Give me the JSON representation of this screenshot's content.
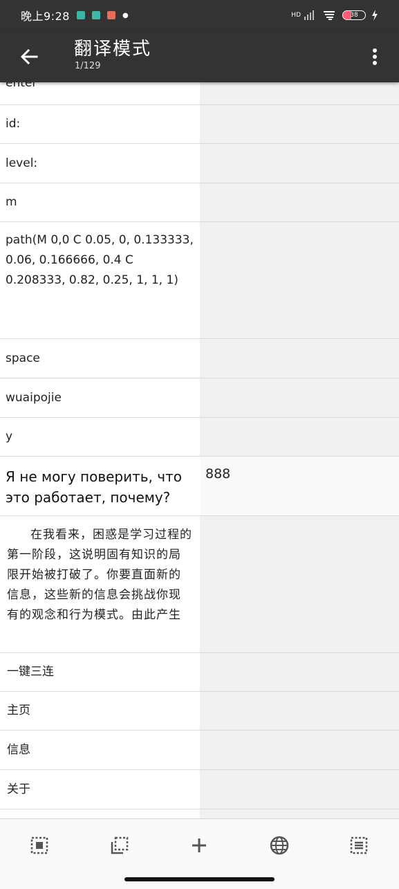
{
  "status_bar": {
    "time": "晚上9:28",
    "network": "HD",
    "battery": "38",
    "battery_level": 0.38,
    "notification_colors": [
      "#36b6a4",
      "#3fb8a8",
      "#e86a5a"
    ]
  },
  "app_bar": {
    "title": "翻译模式",
    "page_indicator": "1/129"
  },
  "rows": [
    {
      "source": "enter",
      "target": ""
    },
    {
      "source": "id:",
      "target": ""
    },
    {
      "source": "level:",
      "target": ""
    },
    {
      "source": "m",
      "target": ""
    },
    {
      "source": "path(M 0,0 C 0.05, 0, 0.133333, 0.06, 0.166666, 0.4 C 0.208333, 0.82, 0.25, 1, 1, 1)",
      "target": ""
    },
    {
      "source": "space",
      "target": ""
    },
    {
      "source": "wuaipojie",
      "target": ""
    },
    {
      "source": "y",
      "target": ""
    },
    {
      "source": "Я не могу поверить, что это работает, почему?",
      "target": "888"
    },
    {
      "source": "在我看来，困惑是学习过程的第一阶段，这说明固有知识的局限开始被打破了。你要直面新的信息，这些新的信息会挑战你现有的观念和行为模式。由此产生",
      "target": ""
    },
    {
      "source": "一键三连",
      "target": ""
    },
    {
      "source": "主页",
      "target": ""
    },
    {
      "source": "信息",
      "target": ""
    },
    {
      "source": "关于",
      "target": ""
    }
  ],
  "toolbar": {
    "icons": [
      "select-all-icon",
      "deselect-icon",
      "add-icon",
      "translate-globe-icon",
      "list-icon"
    ]
  },
  "colors": {
    "appbar_bg": "#333333",
    "right_column_bg": "#f1f1f1",
    "divider": "#d9d9d9"
  }
}
